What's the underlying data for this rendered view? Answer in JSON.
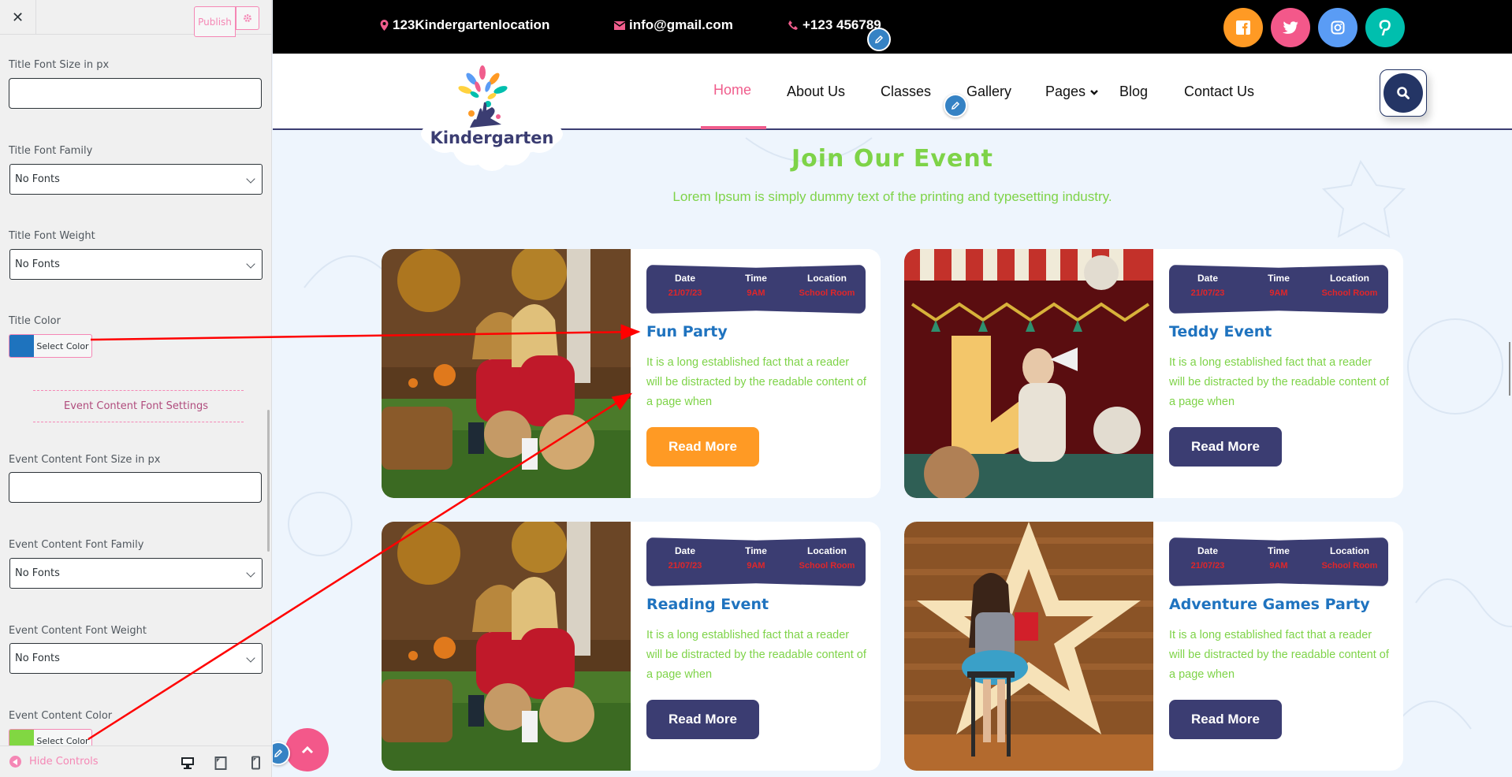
{
  "sidebar": {
    "close_label": "✕",
    "publish_label": "Publish",
    "fields": {
      "title_font_size": {
        "label": "Title Font Size in px",
        "value": ""
      },
      "title_font_family": {
        "label": "Title Font Family",
        "value": "No Fonts"
      },
      "title_font_weight": {
        "label": "Title Font Weight",
        "value": "No Fonts"
      },
      "title_color": {
        "label": "Title Color",
        "button": "Select Color",
        "color": "#1e73be"
      },
      "section_title": "Event Content Font Settings",
      "content_font_size": {
        "label": "Event Content Font Size in px",
        "value": ""
      },
      "content_font_family": {
        "label": "Event Content Font Family",
        "value": "No Fonts"
      },
      "content_font_weight": {
        "label": "Event Content Font Weight",
        "value": "No Fonts"
      },
      "content_color": {
        "label": "Event Content Color",
        "button": "Select Color",
        "color": "#81d742"
      }
    },
    "footer": {
      "hide_controls": "Hide Controls"
    }
  },
  "topbar": {
    "location": "123Kindergartenlocation",
    "email": "info@gmail.com",
    "phone": "+123 456789",
    "social": [
      {
        "name": "facebook",
        "color": "#ff9a24"
      },
      {
        "name": "twitter",
        "color": "#f3588a"
      },
      {
        "name": "instagram",
        "color": "#5a9cf5"
      },
      {
        "name": "pinterest",
        "color": "#00bfae"
      }
    ]
  },
  "nav": {
    "logo_text": "Kindergarten",
    "items": [
      "Home",
      "About Us",
      "Classes",
      "Gallery",
      "Pages",
      "Blog",
      "Contact Us"
    ],
    "active": "Home"
  },
  "section": {
    "title": "Join Our Event",
    "subtitle": "Lorem Ipsum is simply dummy text of the printing and typesetting industry."
  },
  "info_headers": {
    "date": "Date",
    "time": "Time",
    "location": "Location"
  },
  "events": [
    {
      "title": "Fun Party",
      "date": "21/07/23",
      "time": "9AM",
      "location": "School Room",
      "desc": "It is a long established fact that a reader will be distracted by the readable content of a page when",
      "button": "Read More",
      "button_color": "#ff9a24",
      "image": "girls-autumn-teddy"
    },
    {
      "title": "Teddy Event",
      "date": "21/07/23",
      "time": "9AM",
      "location": "School Room",
      "desc": "It is a long established fact that a reader will be distracted by the readable content of a page when",
      "button": "Read More",
      "button_color": "#3b3d72",
      "image": "circus-megaphone"
    },
    {
      "title": "Reading Event",
      "date": "21/07/23",
      "time": "9AM",
      "location": "School Room",
      "desc": "It is a long established fact that a reader will be distracted by the readable content of a page when",
      "button": "Read More",
      "button_color": "#3b3d72",
      "image": "girls-autumn-teddy"
    },
    {
      "title": "Adventure Games Party",
      "date": "21/07/23",
      "time": "9AM",
      "location": "School Room",
      "desc": "It is a long established fact that a reader will be distracted by the readable content of a page when",
      "button": "Read More",
      "button_color": "#3b3d72",
      "image": "girl-star-reading"
    }
  ]
}
